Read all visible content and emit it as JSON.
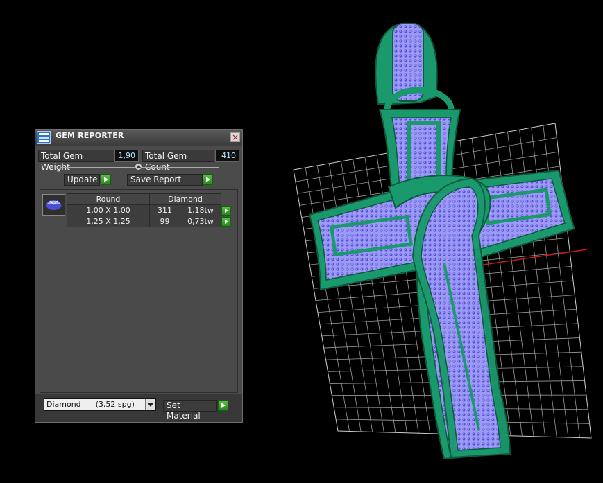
{
  "window": {
    "title": "GEM REPORTER",
    "close_glyph": "×"
  },
  "stats": {
    "weight_label": "Total Gem Weight",
    "weight_value": "1,90",
    "count_label": "Total Gem Count",
    "count_value": "410"
  },
  "actions": {
    "update_label": "Update",
    "save_label": "Save Report"
  },
  "gem_table": {
    "headers": [
      "Round",
      "Diamond"
    ],
    "rows": [
      {
        "size": "1,00 X 1,00",
        "count": "311",
        "weight": "1,18tw"
      },
      {
        "size": "1,25 X 1,25",
        "count": "99",
        "weight": "0,73tw"
      }
    ]
  },
  "material": {
    "selected": "Diamond      (3,52 spg)",
    "set_label": "Set Material"
  },
  "colors": {
    "metal": "#1a9a6c",
    "gem": "#8f8ff0",
    "grid": "#d9d9d9",
    "accent_green": "#3aaa2a"
  },
  "icons": [
    "gem-reporter-app-icon",
    "close-icon",
    "slider-knob-icon",
    "play-arrow-icon",
    "gem-thumbnail-icon",
    "chevron-down-icon"
  ]
}
